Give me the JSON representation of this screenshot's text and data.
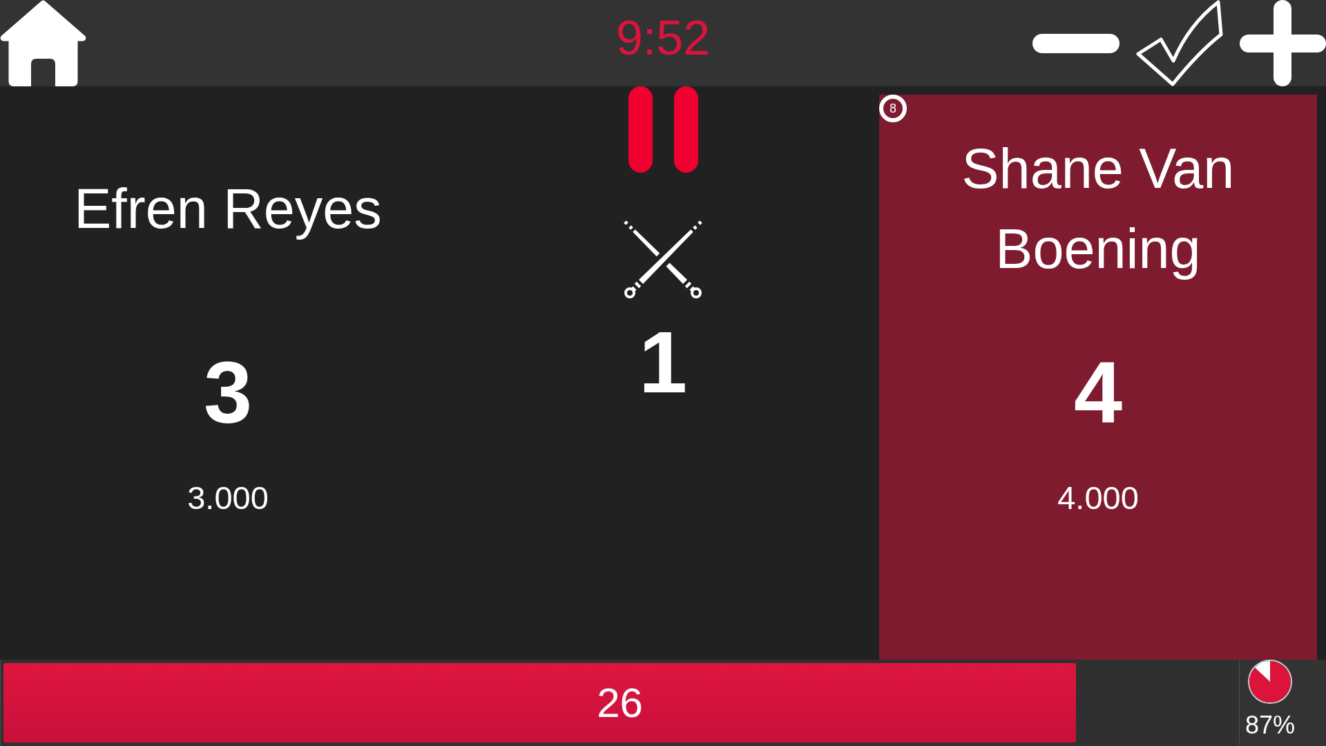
{
  "top_bar": {
    "timer": "9:52"
  },
  "players": [
    {
      "name": "Efren Reyes",
      "score": "3",
      "average": "3.000",
      "selected": false
    },
    {
      "name": "Shane Van Boening",
      "score": "4",
      "average": "4.000",
      "selected": true,
      "ball": "8"
    }
  ],
  "center": {
    "innings": "1"
  },
  "shot_clock": {
    "reading": "26",
    "level": 0.87
  },
  "clock_pie": {
    "chart_data": {
      "type": "pie",
      "values": [
        87,
        13
      ]
    },
    "reading": "87%"
  }
}
